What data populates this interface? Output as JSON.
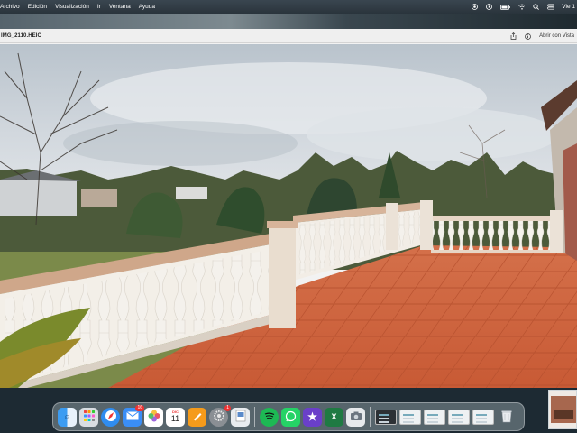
{
  "menubar": {
    "items": [
      "Archivo",
      "Edición",
      "Visualización",
      "Ir",
      "Ventana",
      "Ayuda"
    ],
    "clock": "Vie 1"
  },
  "window": {
    "filename": "IMG_2110.HEIC",
    "open_with_label": "Abrir con Vista"
  },
  "dock": {
    "apps": [
      {
        "name": "finder",
        "badge": ""
      },
      {
        "name": "launchpad",
        "badge": ""
      },
      {
        "name": "safari",
        "badge": ""
      },
      {
        "name": "mail",
        "badge": "16"
      },
      {
        "name": "photos",
        "badge": ""
      },
      {
        "name": "calendar",
        "badge": "",
        "month": "DIC",
        "day": "11"
      },
      {
        "name": "pages",
        "badge": ""
      },
      {
        "name": "system-settings",
        "badge": "1"
      },
      {
        "name": "preview",
        "badge": ""
      },
      {
        "name": "spotify",
        "badge": ""
      },
      {
        "name": "whatsapp",
        "badge": ""
      },
      {
        "name": "imovie",
        "badge": ""
      },
      {
        "name": "excel",
        "badge": ""
      },
      {
        "name": "screenshot-app",
        "badge": ""
      }
    ],
    "recent_windows": 6
  },
  "colors": {
    "menubar": "#2a343c",
    "tile": "#d4683f",
    "sky": "#c9cfd6"
  }
}
